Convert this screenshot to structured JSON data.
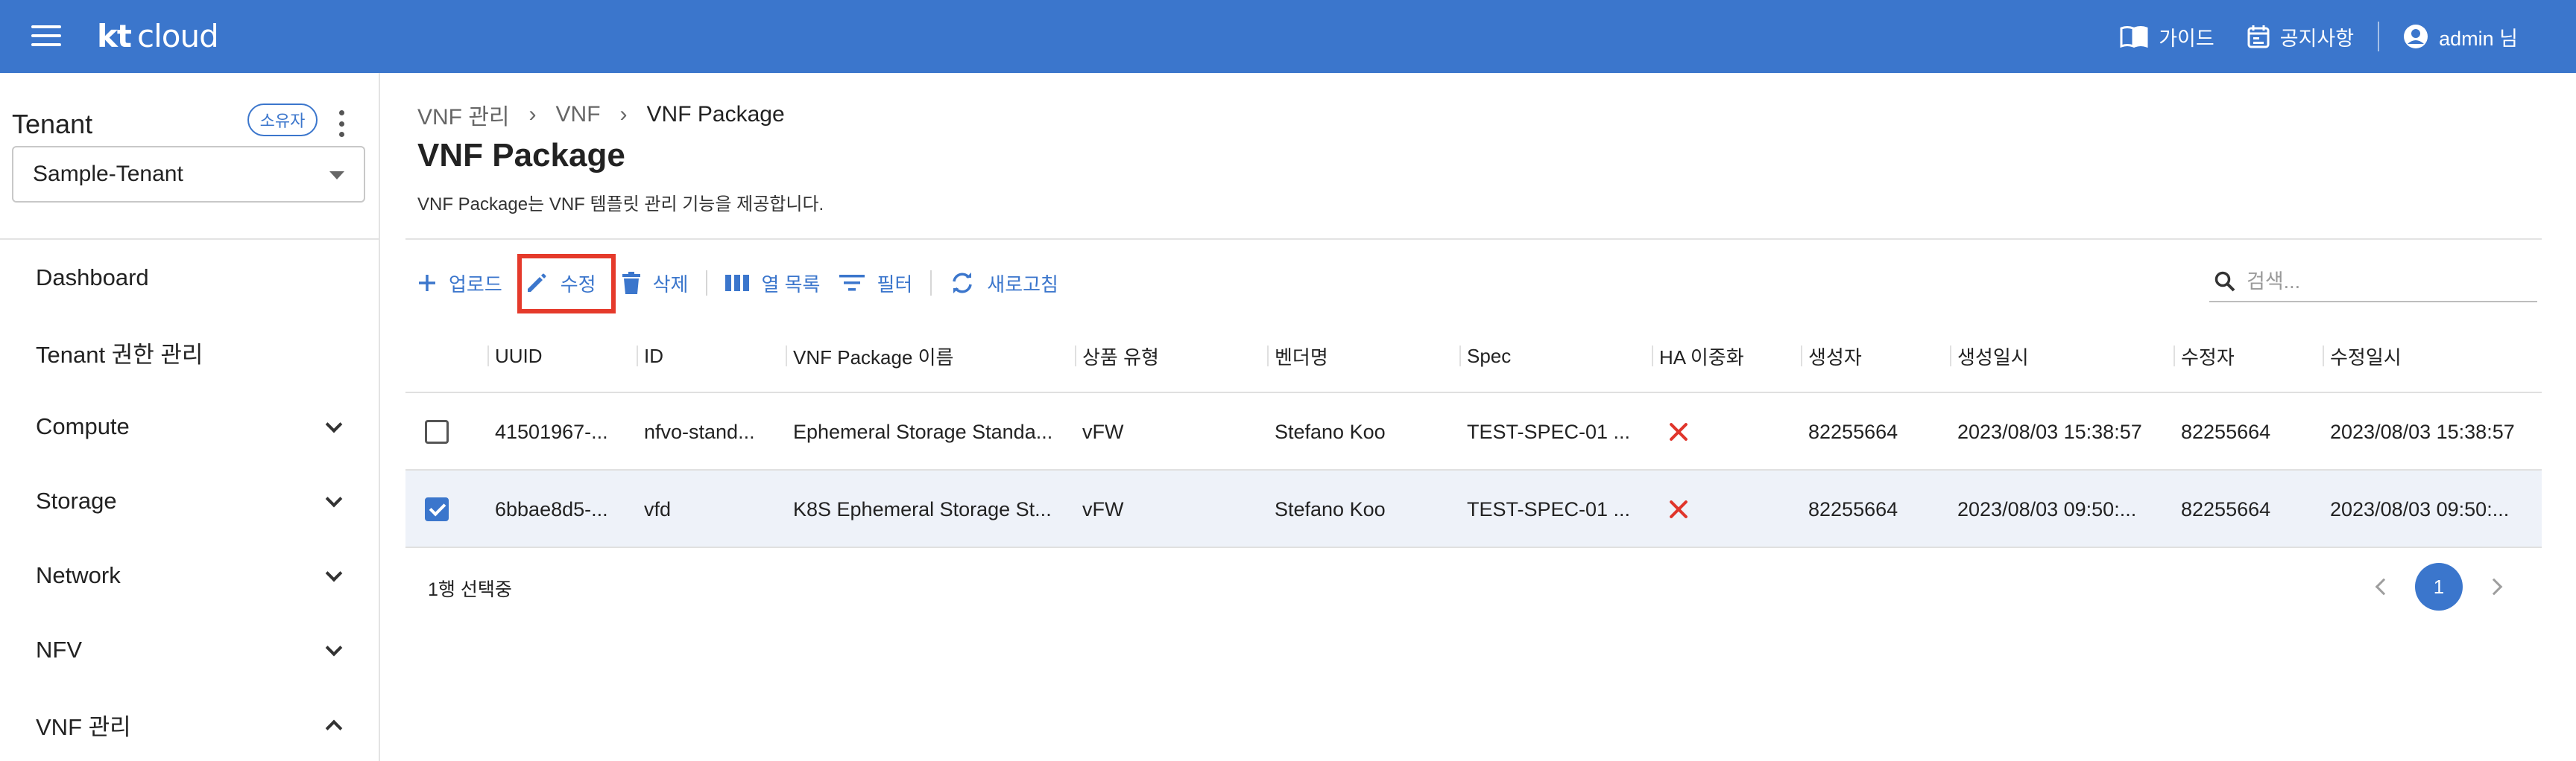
{
  "header": {
    "logo_kt": "kt",
    "logo_cloud": "cloud",
    "guide_label": "가이드",
    "notice_label": "공지사항",
    "user_label": "admin 님",
    "brand_color": "#3b76cc"
  },
  "sidebar": {
    "tenant_title": "Tenant",
    "owner_badge": "소유자",
    "tenant_selected": "Sample-Tenant",
    "items": [
      {
        "label": "Dashboard"
      },
      {
        "label": "Tenant 권한 관리"
      },
      {
        "label": "Compute"
      },
      {
        "label": "Storage"
      },
      {
        "label": "Network"
      },
      {
        "label": "NFV"
      },
      {
        "label": "VNF 관리"
      }
    ]
  },
  "breadcrumb": [
    "VNF 관리",
    "VNF",
    "VNF Package"
  ],
  "page": {
    "title": "VNF Package",
    "description": "VNF Package는 VNF 템플릿 관리 기능을 제공합니다."
  },
  "toolbar": {
    "upload": "업로드",
    "edit": "수정",
    "delete": "삭제",
    "columns": "열 목록",
    "filter": "필터",
    "refresh": "새로고침",
    "highlight_color": "#e53a2b"
  },
  "search": {
    "placeholder": "검색..."
  },
  "table": {
    "headers": [
      "UUID",
      "ID",
      "VNF Package 이름",
      "상품 유형",
      "벤더명",
      "Spec",
      "HA 이중화",
      "생성자",
      "생성일시",
      "수정자",
      "수정일시"
    ],
    "rows": [
      {
        "checked": false,
        "uuid": "41501967-...",
        "id": "nfvo-stand...",
        "name": "Ephemeral Storage Standa...",
        "type": "vFW",
        "vendor": "Stefano Koo",
        "spec": "TEST-SPEC-01 ...",
        "ha": "x-icon",
        "creator": "82255664",
        "created": "2023/08/03 15:38:57",
        "modifier": "82255664",
        "modified": "2023/08/03 15:38:57"
      },
      {
        "checked": true,
        "uuid": "6bbae8d5-...",
        "id": "vfd",
        "name": "K8S Ephemeral Storage St...",
        "type": "vFW",
        "vendor": "Stefano Koo",
        "spec": "TEST-SPEC-01 ...",
        "ha": "x-icon",
        "creator": "82255664",
        "created": "2023/08/03 09:50:...",
        "modifier": "82255664",
        "modified": "2023/08/03 09:50:..."
      }
    ]
  },
  "footer": {
    "selection": "1행 선택중",
    "current_page": "1"
  }
}
